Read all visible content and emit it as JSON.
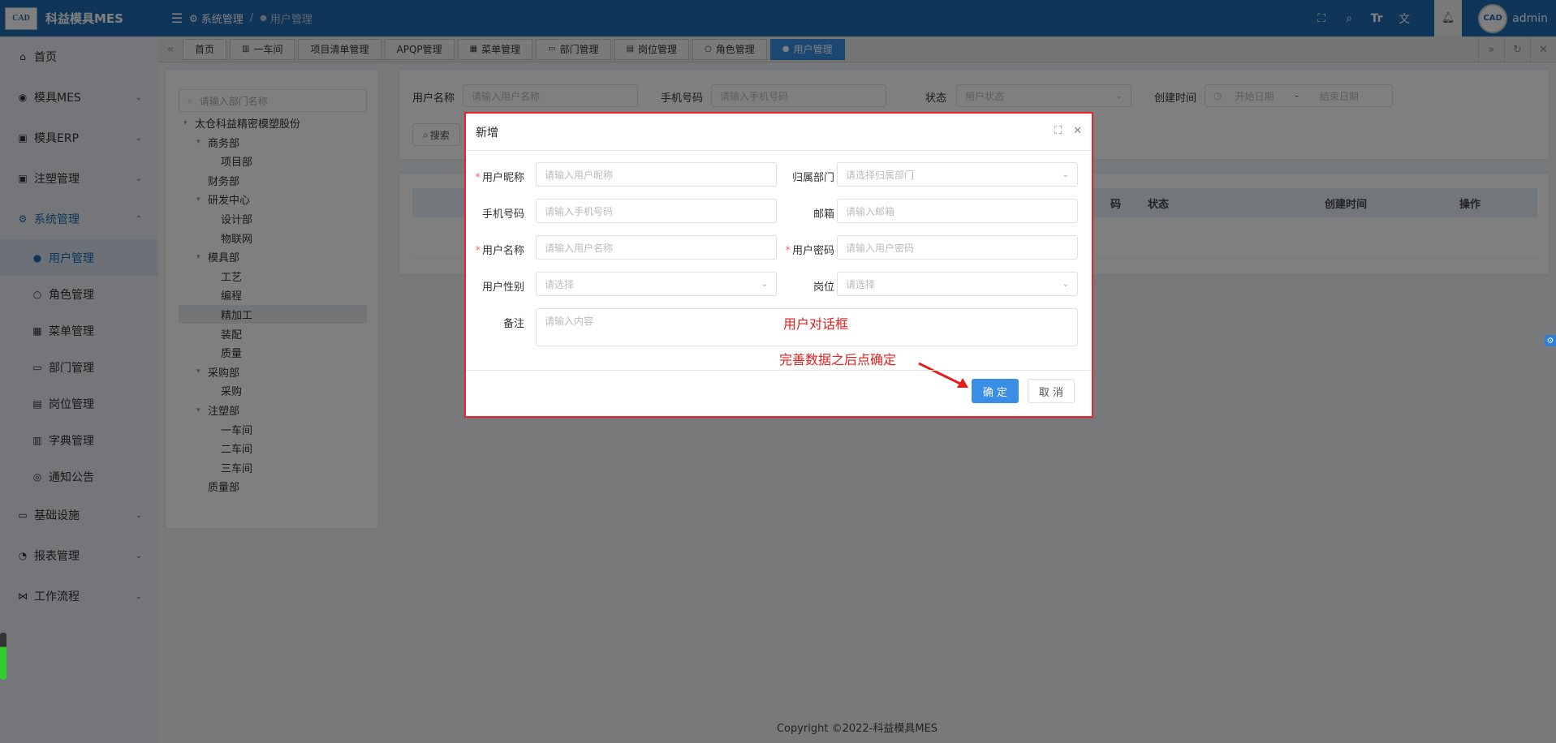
{
  "app": {
    "title": "科益模具MES",
    "logo_text": "CAD"
  },
  "sidebar": {
    "items": [
      {
        "label": "首页",
        "icon": "home-icon",
        "glyph": "⌂"
      },
      {
        "label": "模具MES",
        "icon": "camera-icon",
        "glyph": "◉",
        "chev": "⌄"
      },
      {
        "label": "模具ERP",
        "icon": "briefcase-icon",
        "glyph": "▣",
        "chev": "⌄"
      },
      {
        "label": "注塑管理",
        "icon": "briefcase-icon",
        "glyph": "▣",
        "chev": "⌄"
      },
      {
        "label": "系统管理",
        "icon": "gear-icon",
        "glyph": "⚙",
        "chev": "⌃"
      }
    ],
    "sub_items": [
      {
        "label": "用户管理",
        "icon": "user-icon",
        "glyph": "●"
      },
      {
        "label": "角色管理",
        "icon": "person-icon",
        "glyph": "○"
      },
      {
        "label": "菜单管理",
        "icon": "grid-icon",
        "glyph": "▦"
      },
      {
        "label": "部门管理",
        "icon": "id-card-icon",
        "glyph": "▭"
      },
      {
        "label": "岗位管理",
        "icon": "post-icon",
        "glyph": "▤"
      },
      {
        "label": "字典管理",
        "icon": "book-icon",
        "glyph": "▥"
      },
      {
        "label": "通知公告",
        "icon": "message-icon",
        "glyph": "◎"
      }
    ],
    "bottom_items": [
      {
        "label": "基础设施",
        "icon": "monitor-icon",
        "glyph": "▭",
        "chev": "⌄"
      },
      {
        "label": "报表管理",
        "icon": "chart-icon",
        "glyph": "◔",
        "chev": "⌄"
      },
      {
        "label": "工作流程",
        "icon": "workflow-icon",
        "glyph": "⋈",
        "chev": "⌄"
      }
    ]
  },
  "topbar": {
    "breadcrumb": [
      "系统管理",
      "用户管理"
    ],
    "user_name": "admin"
  },
  "tags": [
    {
      "label": "首页",
      "icon": ""
    },
    {
      "label": "一车间",
      "icon": "▥"
    },
    {
      "label": "项目清单管理",
      "icon": ""
    },
    {
      "label": "APQP管理",
      "icon": ""
    },
    {
      "label": "菜单管理",
      "icon": "▦"
    },
    {
      "label": "部门管理",
      "icon": "▭"
    },
    {
      "label": "岗位管理",
      "icon": "▤"
    },
    {
      "label": "角色管理",
      "icon": "○"
    },
    {
      "label": "用户管理",
      "icon": "●",
      "active": true
    }
  ],
  "tree": {
    "search_placeholder": "请输入部门名称",
    "nodes": [
      {
        "label": "太仓科益精密模塑股份",
        "level": 0,
        "arrow": true
      },
      {
        "label": "商务部",
        "level": 1,
        "arrow": true
      },
      {
        "label": "项目部",
        "level": 2
      },
      {
        "label": "财务部",
        "level": 1
      },
      {
        "label": "研发中心",
        "level": 1,
        "arrow": true
      },
      {
        "label": "设计部",
        "level": 2
      },
      {
        "label": "物联网",
        "level": 2
      },
      {
        "label": "模具部",
        "level": 1,
        "arrow": true
      },
      {
        "label": "工艺",
        "level": 2
      },
      {
        "label": "编程",
        "level": 2
      },
      {
        "label": "精加工",
        "level": 2,
        "selected": true
      },
      {
        "label": "装配",
        "level": 2
      },
      {
        "label": "质量",
        "level": 2
      },
      {
        "label": "采购部",
        "level": 1,
        "arrow": true
      },
      {
        "label": "采购",
        "level": 2
      },
      {
        "label": "注塑部",
        "level": 1,
        "arrow": true
      },
      {
        "label": "一车间",
        "level": 2
      },
      {
        "label": "二车间",
        "level": 2
      },
      {
        "label": "三车间",
        "level": 2
      },
      {
        "label": "质量部",
        "level": 1
      }
    ]
  },
  "filters": {
    "username_label": "用户名称",
    "username_placeholder": "请输入用户名称",
    "phone_label": "手机号码",
    "phone_placeholder": "请输入手机号码",
    "status_label": "状态",
    "status_placeholder": "用户状态",
    "created_label": "创建时间",
    "start_placeholder": "开始日期",
    "range_sep": "-",
    "end_placeholder": "结束日期",
    "search_button": "搜索"
  },
  "table": {
    "headers": [
      "码",
      "状态",
      "创建时间",
      "操作"
    ]
  },
  "copyright": "Copyright ©2022-科益模具MES",
  "dialog": {
    "title": "新增",
    "nickname_label": "用户昵称",
    "nickname_placeholder": "请输入用户昵称",
    "dept_label": "归属部门",
    "dept_placeholder": "请选择归属部门",
    "phone_label": "手机号码",
    "phone_placeholder": "请输入手机号码",
    "email_label": "邮箱",
    "email_placeholder": "请输入邮箱",
    "username_label": "用户名称",
    "username_placeholder": "请输入用户名称",
    "password_label": "用户密码",
    "password_placeholder": "请输入用户密码",
    "gender_label": "用户性别",
    "gender_placeholder": "请选择",
    "post_label": "岗位",
    "post_placeholder": "请选择",
    "remark_label": "备注",
    "remark_placeholder": "请输入内容",
    "annotation_dialog": "用户对话框",
    "annotation_confirm": "完善数据之后点确定",
    "ok_button": "确 定",
    "cancel_button": "取 消"
  }
}
